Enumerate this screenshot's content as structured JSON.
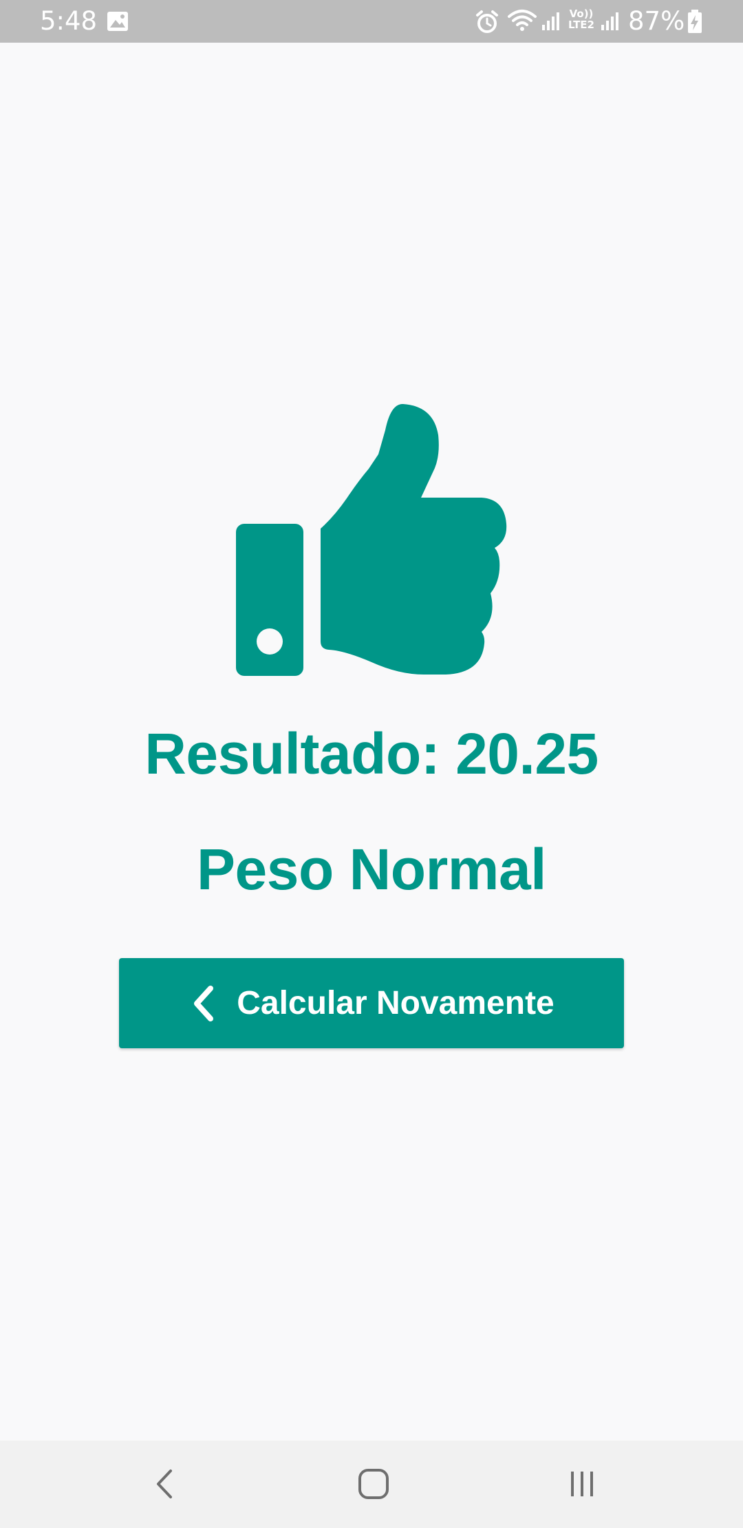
{
  "status_bar": {
    "time": "5:48",
    "network_label_top": "Vo))",
    "network_label_bottom": "LTE2",
    "battery_percent": "87%",
    "icons": [
      "gallery-icon",
      "alarm-icon",
      "wifi-icon",
      "signal-icon",
      "signal-icon-2",
      "battery-charging-icon"
    ]
  },
  "result": {
    "icon": "thumbs-up-icon",
    "label": "Resultado: 20.25",
    "classification": "Peso Normal"
  },
  "actions": {
    "recalculate_label": "Calcular Novamente",
    "recalculate_icon": "chevron-left-icon"
  },
  "nav_bar": {
    "icons": [
      "back-icon",
      "home-icon",
      "recents-icon"
    ]
  },
  "colors": {
    "accent": "#009688",
    "background": "#f9f9fa",
    "status_bar": "#bcbcbc",
    "nav_bar": "#f1f1f1"
  }
}
